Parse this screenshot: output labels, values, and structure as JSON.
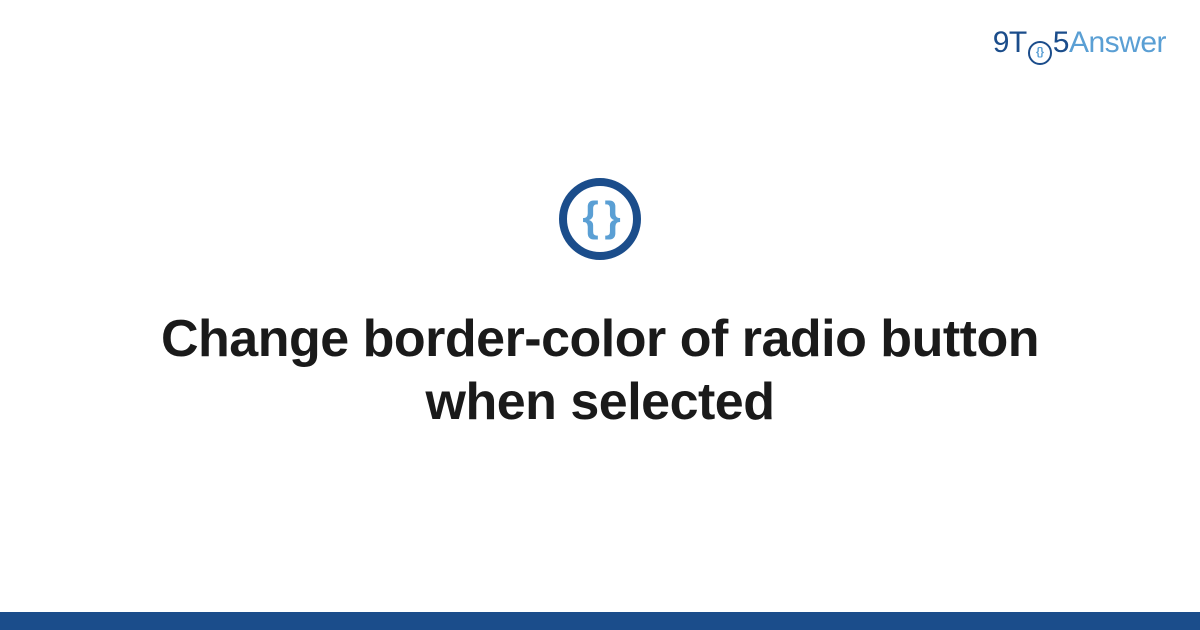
{
  "brand": {
    "part1": "9T",
    "part2": "5",
    "part3": "Answer"
  },
  "logo": {
    "braces": "{ }"
  },
  "title": "Change border-color of radio button when selected",
  "colors": {
    "primary": "#1b4d8b",
    "accent": "#5a9fd4"
  }
}
